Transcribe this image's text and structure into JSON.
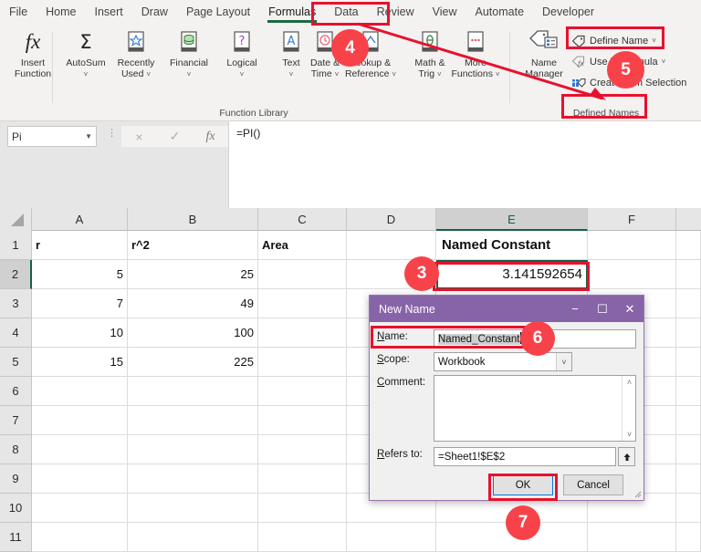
{
  "app": {
    "title": "Microsoft Excel"
  },
  "ribbon": {
    "tabs": [
      {
        "label": "File",
        "active": false
      },
      {
        "label": "Home",
        "active": false
      },
      {
        "label": "Insert",
        "active": false
      },
      {
        "label": "Draw",
        "active": false
      },
      {
        "label": "Page Layout",
        "active": false
      },
      {
        "label": "Formulas",
        "active": true
      },
      {
        "label": "Data",
        "active": false
      },
      {
        "label": "Review",
        "active": false
      },
      {
        "label": "View",
        "active": false
      },
      {
        "label": "Automate",
        "active": false
      },
      {
        "label": "Developer",
        "active": false
      }
    ],
    "groups": [
      {
        "label": "Function Library"
      },
      {
        "label": "Defined Names"
      }
    ],
    "function_library": {
      "insert_function": {
        "line1": "Insert",
        "line2": "Function",
        "icon": "fx-icon"
      },
      "buttons": [
        {
          "line1": "AutoSum",
          "line2": "",
          "caret": true,
          "icon": "sigma-icon"
        },
        {
          "line1": "Recently",
          "line2": "Used",
          "caret": true,
          "icon": "star-book-icon"
        },
        {
          "line1": "Financial",
          "line2": "",
          "caret": true,
          "icon": "database-book-icon"
        },
        {
          "line1": "Logical",
          "line2": "",
          "caret": true,
          "icon": "question-book-icon"
        },
        {
          "line1": "Text",
          "line2": "",
          "caret": true,
          "icon": "letter-a-book-icon"
        },
        {
          "line1": "Date &",
          "line2": "Time",
          "caret": true,
          "icon": "clock-book-icon"
        },
        {
          "line1": "Lookup &",
          "line2": "Reference",
          "caret": true,
          "icon": "lookup-book-icon"
        },
        {
          "line1": "Math &",
          "line2": "Trig",
          "caret": true,
          "icon": "theta-book-icon"
        },
        {
          "line1": "More",
          "line2": "Functions",
          "caret": true,
          "icon": "ellipsis-book-icon"
        }
      ]
    },
    "defined_names": {
      "name_manager": {
        "line1": "Name",
        "line2": "Manager",
        "icon": "name-manager-icon"
      },
      "items": [
        {
          "label": "Define Name",
          "caret": true,
          "icon": "tag-icon"
        },
        {
          "label": "Use in Formula",
          "caret": true,
          "icon": "fx-tag-icon"
        },
        {
          "label": "Create from Selection",
          "caret": false,
          "icon": "create-selection-icon"
        }
      ]
    }
  },
  "formula_bar": {
    "name_box_value": "Pi",
    "cancel_icon": "×",
    "enter_icon": "✓",
    "fx_icon": "fx",
    "formula_value": "=PI()"
  },
  "sheet": {
    "columns": [
      "A",
      "B",
      "C",
      "D",
      "E",
      "F"
    ],
    "selected_column": "E",
    "rows": [
      "1",
      "2",
      "3",
      "4",
      "5",
      "6",
      "7",
      "8",
      "9",
      "10",
      "11"
    ],
    "selected_row": "2",
    "cells": {
      "A1": "r",
      "B1": "r^2",
      "C1": "Area",
      "D1": "",
      "E1": "Named Constant",
      "F1": "",
      "A2": "5",
      "B2": "25",
      "C2": "",
      "D2": "",
      "E2": "3.141592654",
      "F2": "",
      "A3": "7",
      "B3": "49",
      "C3": "",
      "D3": "",
      "E3": "",
      "F3": "",
      "A4": "10",
      "B4": "100",
      "C4": "",
      "D4": "",
      "E4": "",
      "F4": "",
      "A5": "15",
      "B5": "225",
      "C5": "",
      "D5": "",
      "E5": "",
      "F5": ""
    },
    "active_cell": "E2"
  },
  "dialog": {
    "title": "New Name",
    "minimize_icon": "−",
    "maximize_icon": "☐",
    "close_icon": "✕",
    "name_label": "Name:",
    "name_value": "Named_Constant",
    "scope_label": "Scope:",
    "scope_value": "Workbook",
    "comment_label": "Comment:",
    "comment_value": "",
    "refers_to_label": "Refers to:",
    "refers_to_value": "=Sheet1!$E$2",
    "refers_to_picker_icon": "range-picker-icon",
    "ok_label": "OK",
    "cancel_label": "Cancel"
  },
  "annotations": {
    "markers": [
      {
        "number": "3"
      },
      {
        "number": "4"
      },
      {
        "number": "5"
      },
      {
        "number": "6"
      },
      {
        "number": "7"
      }
    ],
    "highlight_color": "#e8112d",
    "marker_color": "#f8424a"
  }
}
